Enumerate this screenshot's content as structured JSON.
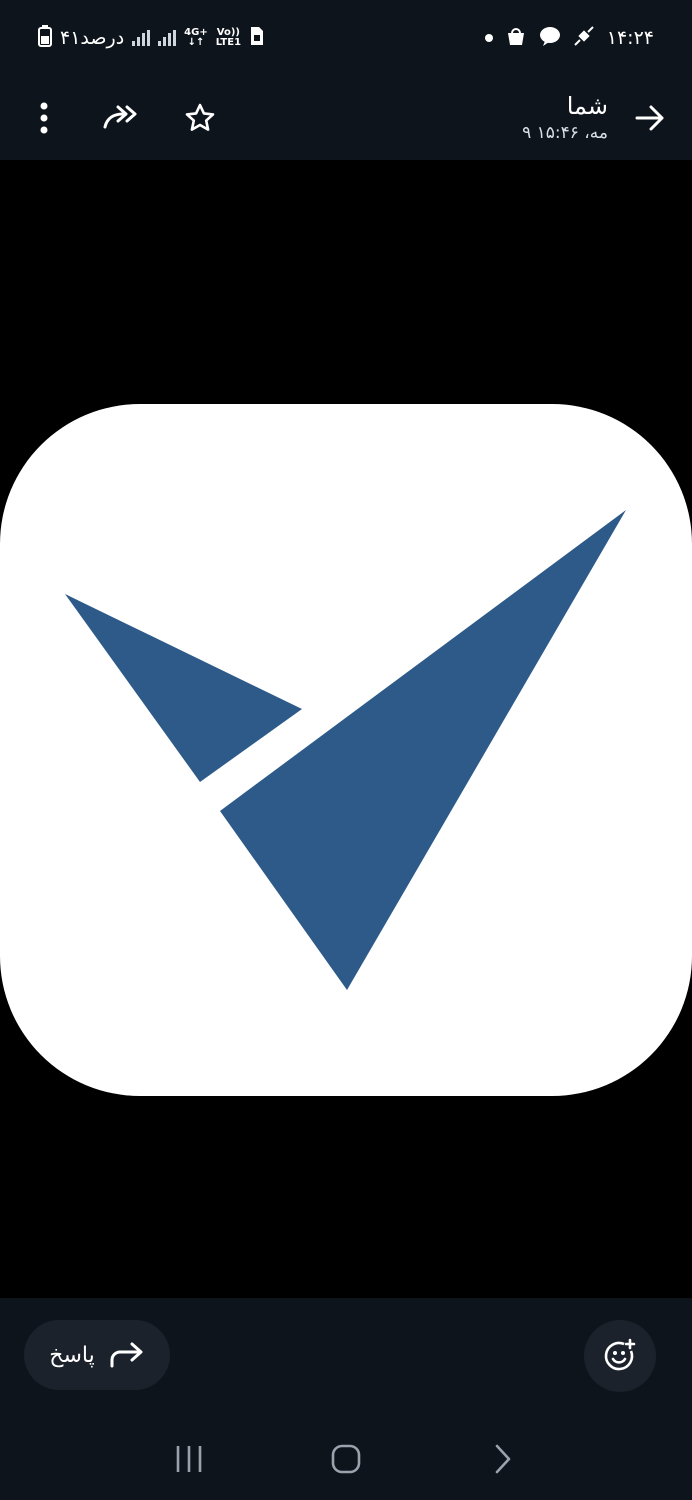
{
  "status": {
    "time": "۱۴:۲۴",
    "battery_text": "۴۱درصد",
    "network_top": "4G+",
    "network_volte": "Vo))",
    "network_lte": "LTE1"
  },
  "header": {
    "sender_name": "شما",
    "timestamp": "۹ مه، ۱۵:۴۶"
  },
  "bottom": {
    "reply_label": "پاسخ"
  },
  "colors": {
    "logo_blue": "#2d5a88",
    "bar_bg": "#0e141b",
    "pill_bg": "#1b222b"
  }
}
